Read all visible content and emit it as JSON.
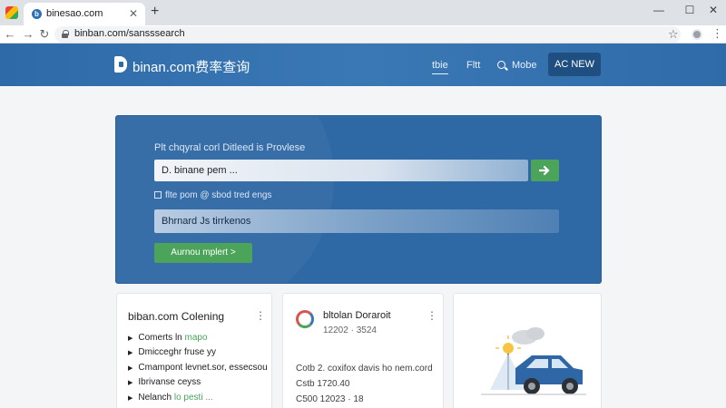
{
  "browser": {
    "tab_title": "binesao.com",
    "favicon_letter": "b",
    "url": "binban.com/sansssearch",
    "controls": {
      "close": "✕",
      "new_tab": "+",
      "minimize": "—",
      "maximize": "☐",
      "window_close": "✕"
    },
    "icons": [
      "back-arrow-icon",
      "forward-arrow-icon",
      "reload-icon",
      "lock-icon",
      "star-icon",
      "profile-icon",
      "kebab-icon"
    ]
  },
  "header": {
    "site_name": "binan.com费率查询",
    "nav": [
      "tbie",
      "Fltt",
      "Mobe"
    ],
    "cta": "AC NEW"
  },
  "hero": {
    "title": "Plt chqyral corl Ditleed is Provlese",
    "search_value": "D. binane pem ...",
    "hint": "flte pom @ sbod tred engs",
    "field2_value": "Bhrnard Js tirrkenos",
    "submit_label": "Aurnou mplert >"
  },
  "cards": [
    {
      "title": "biban.com Colening",
      "items": [
        {
          "prefix": "Comerts ln ",
          "accent": "mapo"
        },
        {
          "prefix": "Dmicceghr fruse yy",
          "accent": ""
        },
        {
          "prefix": "Cmampont levnet.sor, essecsou",
          "accent": ""
        },
        {
          "prefix": "Ibrivanse ceyss",
          "accent": ""
        },
        {
          "prefix": "Nelanch ",
          "accent": "lo pesti ..."
        }
      ]
    },
    {
      "title": "bltolan Doraroit",
      "subtitle": "12202 · 3524",
      "rows": [
        "Cotb 2. coxifox davis ho nem.cord",
        "Cstb   1720.40",
        "C500   12023 · 18"
      ]
    },
    {
      "illustration": "car-illustration"
    }
  ],
  "colors": {
    "header_blue": "#2e6aa7",
    "hero_blue": "#2f69a5",
    "cta_dark": "#1f4f80",
    "green": "#4ca35a"
  }
}
